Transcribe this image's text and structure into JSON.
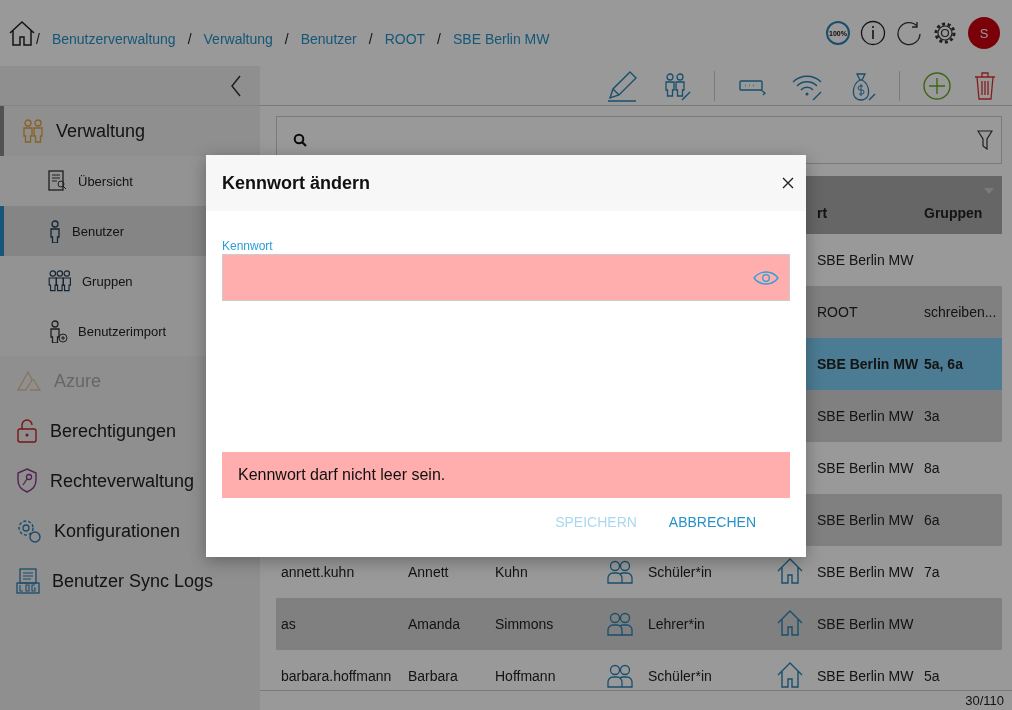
{
  "breadcrumbs": [
    {
      "separator": "/",
      "label": "Benutzerverwaltung"
    },
    {
      "separator": "/",
      "label": "Verwaltung"
    },
    {
      "separator": "/",
      "label": "Benutzer"
    },
    {
      "separator": "/",
      "label": "ROOT"
    },
    {
      "separator": "/",
      "label": "SBE Berlin MW"
    }
  ],
  "header": {
    "zoom": "100%",
    "avatar": "S"
  },
  "sidebar": {
    "items": [
      {
        "label": "Verwaltung",
        "disabled": false,
        "children": [
          {
            "label": "Übersicht",
            "selected": false
          },
          {
            "label": "Benutzer",
            "selected": true
          },
          {
            "label": "Gruppen",
            "selected": false
          },
          {
            "label": "Benutzerimport",
            "selected": false
          }
        ]
      },
      {
        "label": "Azure",
        "disabled": true
      },
      {
        "label": "Berechtigungen",
        "disabled": false
      },
      {
        "label": "Rechteverwaltung",
        "disabled": false
      },
      {
        "label": "Konfigurationen",
        "disabled": false
      },
      {
        "label": "Benutzer Sync Logs",
        "disabled": false
      }
    ]
  },
  "table": {
    "columns": [
      "rt",
      "Gruppen"
    ],
    "rows": [
      {
        "location": "SBE Berlin MW",
        "selected": false
      },
      {
        "location": "ROOT",
        "groups": "schreiben...",
        "selected": false
      },
      {
        "location": "SBE Berlin MW",
        "groups": "5a, 6a",
        "selected": true
      },
      {
        "location": "SBE Berlin MW",
        "groups": "3a",
        "selected": false
      },
      {
        "location": "SBE Berlin MW",
        "groups": "8a",
        "selected": false
      },
      {
        "location": "SBE Berlin MW",
        "groups": "6a",
        "selected": false
      },
      {
        "username": "annett.kuhn",
        "first_name": "Annett",
        "last_name": "Kuhn",
        "role": "Schüler*in",
        "location": "SBE Berlin MW",
        "groups": "7a",
        "selected": false
      },
      {
        "username": "as",
        "first_name": "Amanda",
        "last_name": "Simmons",
        "role": "Lehrer*in",
        "location": "SBE Berlin MW",
        "selected": false
      },
      {
        "username": "barbara.hoffmann",
        "first_name": "Barbara",
        "last_name": "Hoffmann",
        "role": "Schüler*in",
        "location": "SBE Berlin MW",
        "groups": "5a",
        "selected": false
      }
    ]
  },
  "pagination": "30/110",
  "dialog": {
    "title": "Kennwort ändern",
    "field_label": "Kennwort",
    "error": "Kennwort darf nicht leer sein.",
    "buttons": [
      {
        "label": "SPEICHERN",
        "disabled": true
      },
      {
        "label": "ABBRECHEN",
        "disabled": false
      }
    ]
  }
}
